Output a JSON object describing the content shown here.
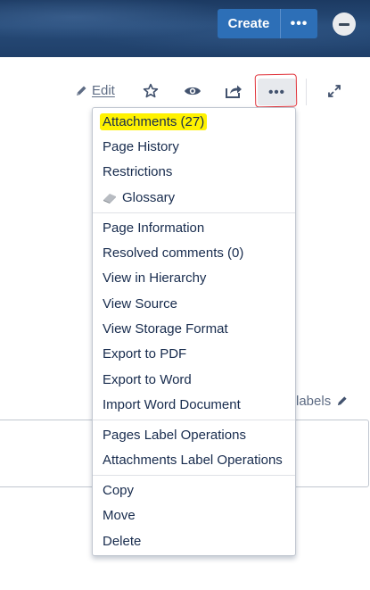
{
  "header": {
    "create_label": "Create",
    "more_label": "•••"
  },
  "toolbar": {
    "edit_label": "Edit",
    "more_label": "•••"
  },
  "page": {
    "labels_label": "labels"
  },
  "menu": {
    "group1": [
      "Attachments (27)",
      "Page History",
      "Restrictions",
      "Glossary"
    ],
    "group2": [
      "Page Information",
      "Resolved comments (0)",
      "View in Hierarchy",
      "View Source",
      "View Storage Format",
      "Export to PDF",
      "Export to Word",
      "Import Word Document"
    ],
    "group3": [
      "Pages Label Operations",
      "Attachments Label Operations"
    ],
    "group4": [
      "Copy",
      "Move",
      "Delete"
    ]
  },
  "colors": {
    "highlight": "#fff200",
    "annotation": "#e0323a",
    "create_button": "#2d6fb7"
  }
}
